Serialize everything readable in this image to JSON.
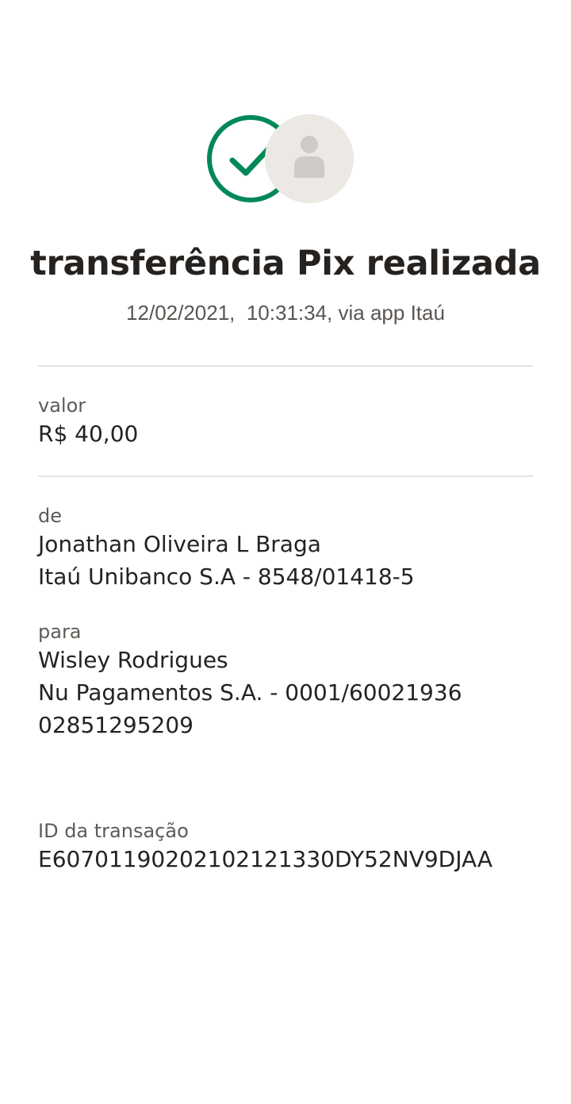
{
  "header": {
    "title": "transferência Pix realizada",
    "datetime_line": "12/02/2021,  10:31:34, via app Itaú"
  },
  "status_icon": "check-circle-icon",
  "recipient_avatar_icon": "person-icon",
  "colors": {
    "success_green": "#008859",
    "avatar_bg": "#ece8e4",
    "avatar_person": "#cfcac5",
    "divider": "#e6e3e0"
  },
  "amount": {
    "label": "valor",
    "value": "R$ 40,00"
  },
  "from": {
    "label": "de",
    "name": "Jonathan Oliveira L Braga",
    "bank_account": "Itaú Unibanco S.A - 8548/01418-5"
  },
  "to": {
    "label": "para",
    "name": "Wisley Rodrigues",
    "bank_account": "Nu Pagamentos S.A. - 0001/60021936",
    "document": "02851295209"
  },
  "transaction": {
    "label": "ID da transação",
    "id": "E60701190202102121330DY52NV9DJAA"
  }
}
